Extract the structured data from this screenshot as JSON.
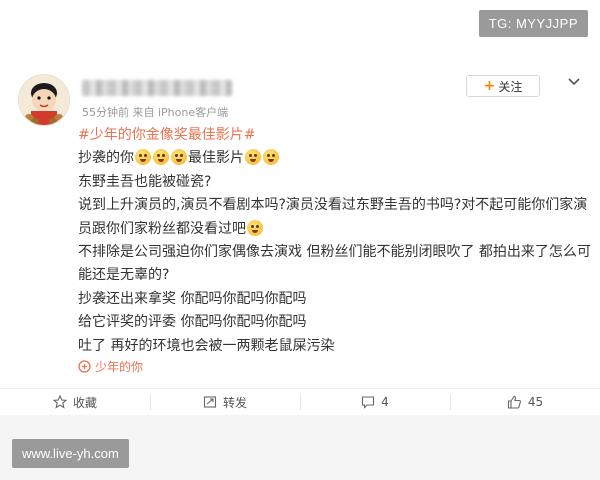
{
  "watermarks": {
    "top": "TG: MYYJJPP",
    "bottom": "www.live-yh.com"
  },
  "header": {
    "meta": "55分钟前 来自 iPhone客户端",
    "follow_label": "关注"
  },
  "post": {
    "topic": "#少年的你金像奖最佳影片#",
    "line1_a": "抄袭的你",
    "line1_b": "最佳影片",
    "line2": "东野圭吾也能被碰瓷?",
    "para1": "说到上升演员的,演员不看剧本吗?演员没看过东野圭吾的书吗?对不起可能你们家演员跟你们家粉丝都没看过吧",
    "para2": "不排除是公司强迫你们家偶像去演戏 但粉丝们能不能别闭眼吹了 都拍出来了怎么可能还是无辜的?",
    "line5": "抄袭还出来拿奖 你配吗你配吗你配吗",
    "line6": "给它评奖的评委 你配吗你配吗你配吗",
    "line7": "吐了 再好的环境也会被一两颗老鼠屎污染"
  },
  "source_link": "少年的你",
  "actions": {
    "favorite": "收藏",
    "repost": "转发",
    "comments": "4",
    "likes": "45"
  },
  "colors": {
    "accent": "#eb7350",
    "follow_plus": "#ff8200"
  }
}
